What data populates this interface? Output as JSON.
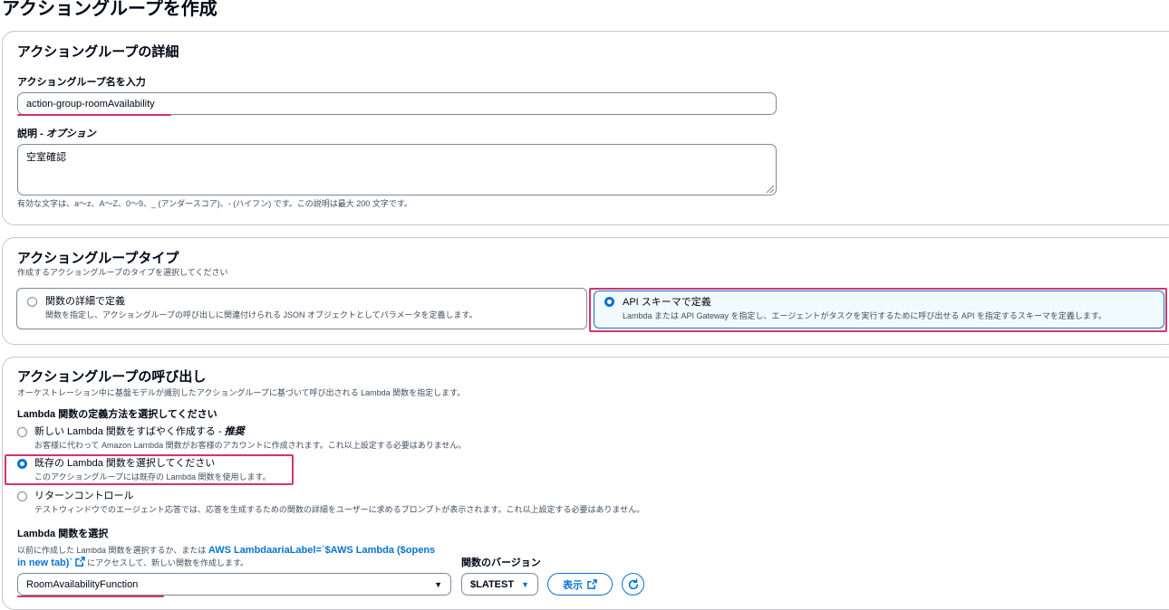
{
  "page": {
    "title": "アクショングループを作成"
  },
  "details": {
    "heading": "アクショングループの詳細",
    "name_label": "アクショングループ名を入力",
    "name_value": "action-group-roomAvailability",
    "description_label_prefix": "説明 - ",
    "description_label_optional": "オプション",
    "description_value": "空室確認",
    "constraint_text": "有効な文字は、a〜z、A〜Z、0〜9、_ (アンダースコア)、- (ハイフン) です。この説明は最大 200 文字です。"
  },
  "type_section": {
    "heading": "アクショングループタイプ",
    "subtitle": "作成するアクショングループのタイプを選択してください",
    "options": [
      {
        "label": "関数の詳細で定義",
        "description": "関数を指定し、アクショングループの呼び出しに関連付けられる JSON オブジェクトとしてパラメータを定義します。",
        "selected": false
      },
      {
        "label": "API スキーマで定義",
        "description": "Lambda または API Gateway を指定し、エージェントがタスクを実行するために呼び出せる API を指定するスキーマを定義します。",
        "selected": true
      }
    ]
  },
  "invocation": {
    "heading": "アクショングループの呼び出し",
    "subtitle": "オーケストレーション中に基盤モデルが識別したアクショングループに基づいて呼び出される Lambda 関数を指定します。",
    "method_label": "Lambda 関数の定義方法を選択してください",
    "options": [
      {
        "label": "新しい Lambda 関数をすばやく作成する - ",
        "label_emphasis": "推奨",
        "description": "お客様に代わって Amazon Lambda 関数がお客様のアカウントに作成されます。これ以上設定する必要はありません。",
        "selected": false
      },
      {
        "label": "既存の Lambda 関数を選択してください",
        "label_emphasis": "",
        "description": "このアクショングループには既存の Lambda 関数を使用します。",
        "selected": true
      },
      {
        "label": "リターンコントロール",
        "label_emphasis": "",
        "description": "テストウィンドウでのエージェント応答では、応答を生成するための関数の詳細をユーザーに求めるプロンプトが表示されます。これ以上設定する必要はありません。",
        "selected": false
      }
    ],
    "select_label": "Lambda 関数を選択",
    "select_help_prefix": "以前に作成した Lambda 関数を選択するか、または ",
    "select_help_link_line1": "AWS LambdaariaLabel=`$AWS Lambda ($opens",
    "select_help_link_line2": "in new tab)`",
    "select_help_suffix": " にアクセスして、新しい関数を作成します。",
    "function_value": "RoomAvailabilityFunction",
    "version_label": "関数のバージョン",
    "version_value": "$LATEST",
    "view_button": "表示"
  },
  "colors": {
    "accent": "#0972d3",
    "annotation": "#d6336c",
    "border": "#c6c6cd"
  },
  "icons": [
    "external-link-icon",
    "refresh-icon",
    "caret-down-icon",
    "resize-grip-icon"
  ]
}
